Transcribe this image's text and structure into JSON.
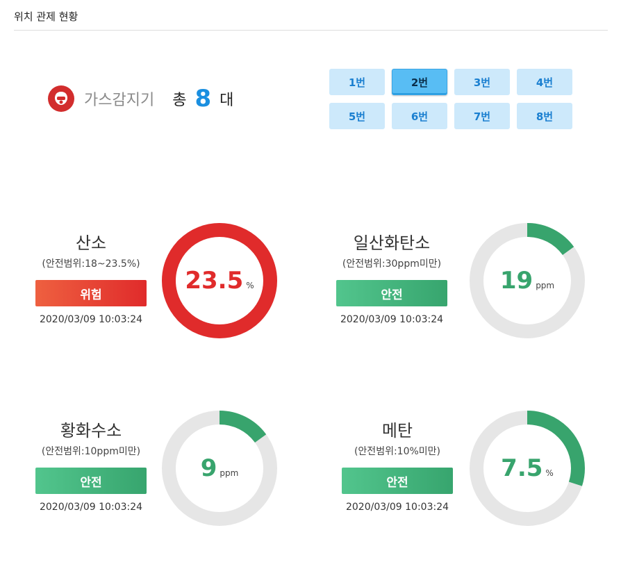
{
  "page": {
    "title": "위치 관제 현황"
  },
  "summary": {
    "device_name": "가스감지기",
    "total_prefix": "총",
    "total_count": "8",
    "total_suffix": "대"
  },
  "units": [
    {
      "label": "1번",
      "active": false
    },
    {
      "label": "2번",
      "active": true
    },
    {
      "label": "3번",
      "active": false
    },
    {
      "label": "4번",
      "active": false
    },
    {
      "label": "5번",
      "active": false
    },
    {
      "label": "6번",
      "active": false
    },
    {
      "label": "7번",
      "active": false
    },
    {
      "label": "8번",
      "active": false
    }
  ],
  "colors": {
    "danger": "#e02b2b",
    "safe": "#38a46d",
    "track": "#e6e6e6",
    "accent": "#1a8fe0"
  },
  "sensors": [
    {
      "name": "산소",
      "range": "(안전범위:18~23.5%)",
      "status": "위험",
      "status_type": "danger",
      "time": "2020/03/09 10:03:24",
      "value": "23.5",
      "unit": "%",
      "fill_fraction": 1.0
    },
    {
      "name": "일산화탄소",
      "range": "(안전범위:30ppm미만)",
      "status": "안전",
      "status_type": "safe",
      "time": "2020/03/09 10:03:24",
      "value": "19",
      "unit": "ppm",
      "fill_fraction": 0.15
    },
    {
      "name": "황화수소",
      "range": "(안전범위:10ppm미만)",
      "status": "안전",
      "status_type": "safe",
      "time": "2020/03/09 10:03:24",
      "value": "9",
      "unit": "ppm",
      "fill_fraction": 0.15
    },
    {
      "name": "메탄",
      "range": "(안전범위:10%미만)",
      "status": "안전",
      "status_type": "safe",
      "time": "2020/03/09 10:03:24",
      "value": "7.5",
      "unit": "%",
      "fill_fraction": 0.3
    }
  ]
}
